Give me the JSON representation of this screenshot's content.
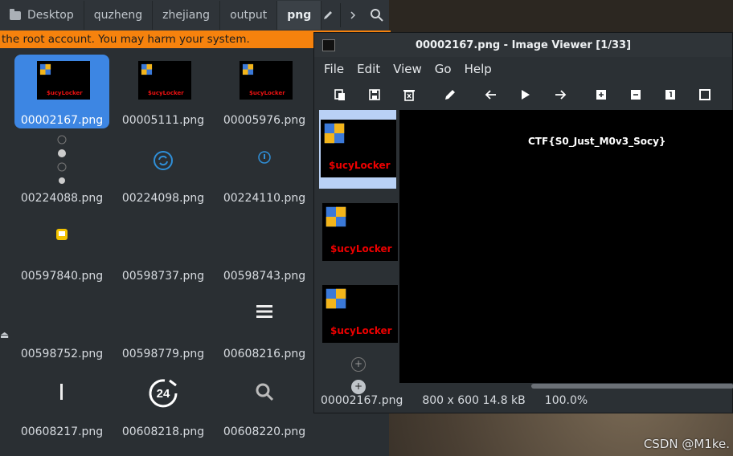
{
  "file_manager": {
    "breadcrumb": [
      "Desktop",
      "quzheng",
      "zhejiang",
      "output",
      "png"
    ],
    "warning_text": "the root account. You may harm your system.",
    "files": [
      "00002167.png",
      "00005111.png",
      "00005976.png",
      "00224088.png",
      "00224098.png",
      "00224110.png",
      "00597840.png",
      "00598737.png",
      "00598743.png",
      "00598752.png",
      "00598779.png",
      "00608216.png",
      "00608217.png",
      "00608218.png",
      "00608220.png"
    ],
    "thumb_brand": "$ucyLocker",
    "icon_24": "24"
  },
  "viewer": {
    "title": "00002167.png - Image Viewer [1/33]",
    "menu": [
      "File",
      "Edit",
      "View",
      "Go",
      "Help"
    ],
    "flag_text": "CTF{S0_Just_M0v3_Socy}",
    "thumb_brand": "$ucyLocker",
    "status": {
      "filename": "00002167.png",
      "dimensions": "800 x 600 14.8 kB",
      "zoom": "100.0%"
    }
  },
  "watermark": "CSDN @M1ke.",
  "colors": {
    "selection": "#3d86e3",
    "warning": "#f6820d",
    "brand_red": "#e00000"
  }
}
